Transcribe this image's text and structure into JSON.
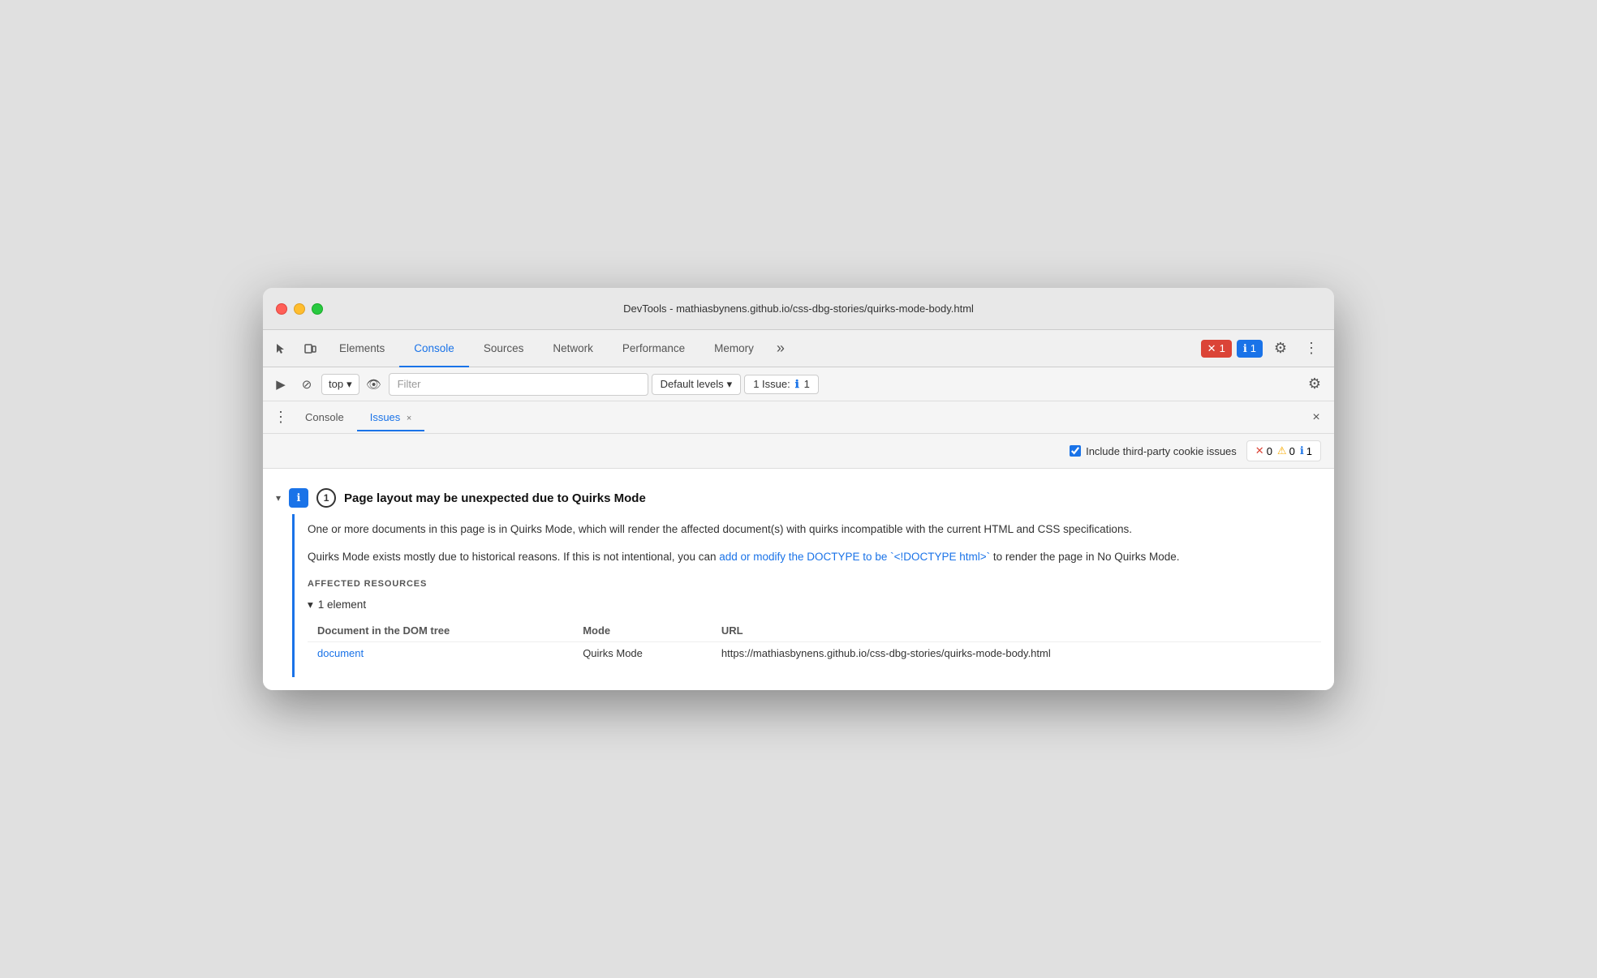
{
  "window": {
    "title": "DevTools - mathiasbynens.github.io/css-dbg-stories/quirks-mode-body.html"
  },
  "toolbar": {
    "tabs": [
      {
        "id": "elements",
        "label": "Elements",
        "active": false
      },
      {
        "id": "console",
        "label": "Console",
        "active": true
      },
      {
        "id": "sources",
        "label": "Sources",
        "active": false
      },
      {
        "id": "network",
        "label": "Network",
        "active": false
      },
      {
        "id": "performance",
        "label": "Performance",
        "active": false
      },
      {
        "id": "memory",
        "label": "Memory",
        "active": false
      }
    ],
    "more_tabs_icon": "»",
    "error_count": "1",
    "info_count": "1"
  },
  "secondary_toolbar": {
    "top_selector": "top",
    "filter_placeholder": "Filter",
    "default_levels_label": "Default levels",
    "issue_label": "1 Issue:",
    "issue_count": "1"
  },
  "sub_tabs": {
    "items": [
      {
        "id": "console",
        "label": "Console",
        "closable": false
      },
      {
        "id": "issues",
        "label": "Issues",
        "closable": true
      }
    ],
    "active": "issues"
  },
  "issues_filter_bar": {
    "checkbox_label": "Include third-party cookie issues",
    "error_count": "0",
    "warning_count": "0",
    "info_count": "1"
  },
  "issue": {
    "title": "Page layout may be unexpected due to Quirks Mode",
    "count": "1",
    "description_para1": "One or more documents in this page is in Quirks Mode, which will render the affected document(s) with quirks incompatible with the current HTML and CSS specifications.",
    "description_para2_prefix": "Quirks Mode exists mostly due to historical reasons. If this is not intentional, you can ",
    "description_link": "add or modify the DOCTYPE to be `<!DOCTYPE html>`",
    "description_para2_suffix": " to render the page in No Quirks Mode.",
    "affected_label": "Affected Resources",
    "element_toggle": "1 element",
    "table": {
      "col1_header": "Document in the DOM tree",
      "col2_header": "Mode",
      "col3_header": "URL",
      "rows": [
        {
          "col1_link": "document",
          "col2": "Quirks Mode",
          "col3": "https://mathiasbynens.github.io/css-dbg-stories/quirks-mode-body.html"
        }
      ]
    }
  },
  "icons": {
    "cursor": "⬱",
    "layers": "⧉",
    "play": "▶",
    "block": "⊘",
    "eye": "👁",
    "chevron_down": "▾",
    "chevron_right": "▸",
    "gear": "⚙",
    "close": "×",
    "dots": "⋮",
    "more": "»",
    "info_square": "ℹ",
    "error_x": "✕",
    "warning_triangle": "⚠"
  }
}
